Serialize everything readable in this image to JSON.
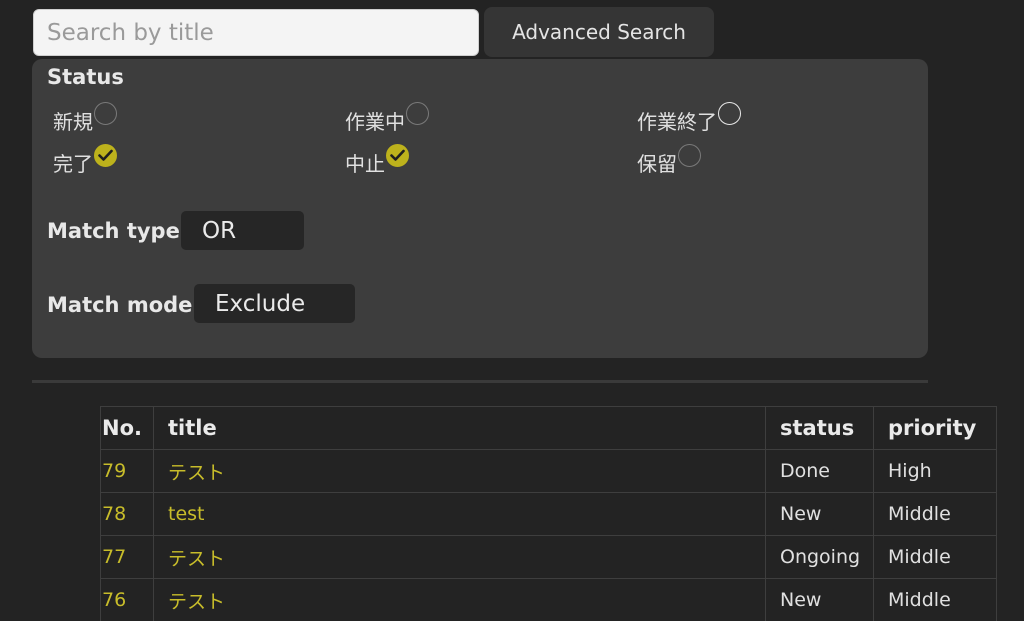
{
  "search": {
    "placeholder": "Search by title",
    "value": ""
  },
  "advanced_search_label": "Advanced Search",
  "filter": {
    "status_title": "Status",
    "status_options": [
      {
        "label": "新規",
        "checked": false
      },
      {
        "label": "作業中",
        "checked": false
      },
      {
        "label": "作業終了",
        "checked": false
      },
      {
        "label": "完了",
        "checked": true
      },
      {
        "label": "中止",
        "checked": true
      },
      {
        "label": "保留",
        "checked": false
      }
    ],
    "match_type_label": "Match type",
    "match_type_value": "OR",
    "match_mode_label": "Match mode",
    "match_mode_value": "Exclude"
  },
  "table": {
    "headers": [
      "No.",
      "title",
      "status",
      "priority"
    ],
    "rows": [
      {
        "no": "79",
        "title": "テスト",
        "status": "Done",
        "priority": "High"
      },
      {
        "no": "78",
        "title": "test",
        "status": "New",
        "priority": "Middle"
      },
      {
        "no": "77",
        "title": "テスト",
        "status": "Ongoing",
        "priority": "Middle"
      },
      {
        "no": "76",
        "title": "テスト",
        "status": "New",
        "priority": "Middle"
      }
    ]
  },
  "colors": {
    "accent": "#bdb21c",
    "background": "#232323",
    "panel": "#3d3d3d"
  }
}
